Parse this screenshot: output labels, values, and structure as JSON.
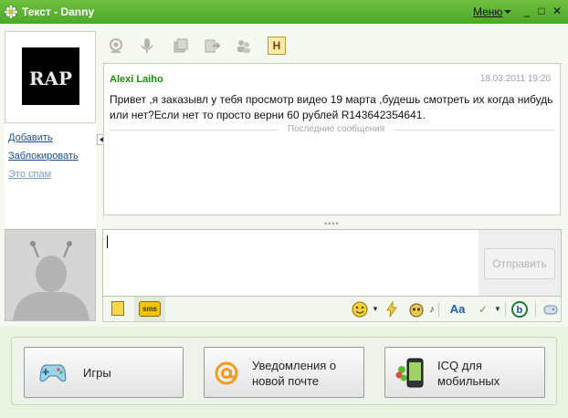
{
  "window": {
    "title": "Текст - Danny",
    "menu_label": "Меню",
    "minimize": "_",
    "maximize": "□",
    "close": "✕"
  },
  "contact": {
    "avatar_text": "RAP",
    "links": {
      "add": "Добавить",
      "block": "Заблокировать",
      "spam": "Это спам"
    }
  },
  "toolbar": {
    "icons": [
      "webcam-icon",
      "microphone-icon",
      "file-transfer-icon",
      "forward-icon",
      "contacts-icon",
      "history-icon"
    ],
    "history_label": "H"
  },
  "conversation": {
    "sender": "Alexi Laiho",
    "timestamp": "18.03.2011 19:20",
    "message": "Привет ,я заказывл у тебя просмотр видео 19 марта ,будешь смотреть их когда нибудь или нет?Если нет то просто верни 60 рублей R143642354641.",
    "divider_label": "Последние сообщения"
  },
  "compose": {
    "value": "",
    "send_label": "Отправить",
    "sms_label": "sms"
  },
  "promos": [
    {
      "label": "Игры"
    },
    {
      "label_line1": "Уведомления о",
      "label_line2": "новой почте"
    },
    {
      "label_line1": "ICQ для",
      "label_line2": "мобильных"
    }
  ],
  "colors": {
    "titlebar": "#5cb331",
    "sender": "#1f8a10",
    "link": "#1a4f9c"
  }
}
